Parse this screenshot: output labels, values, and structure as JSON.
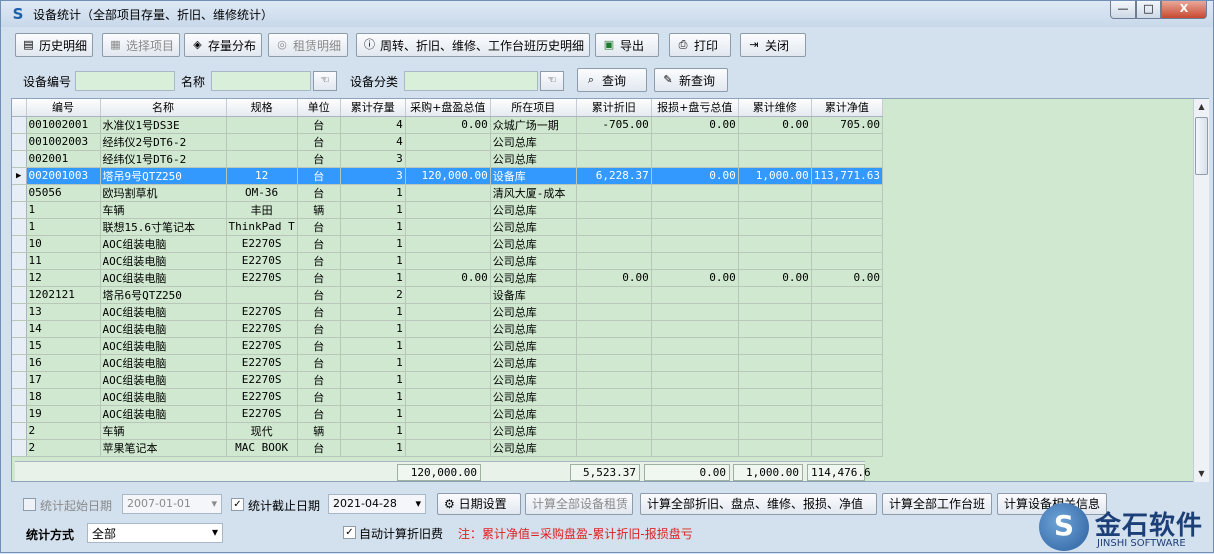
{
  "window": {
    "title": "设备统计（全部项目存量、折旧、维修统计）",
    "min": "—",
    "max": "□",
    "close": "X"
  },
  "toolbar": {
    "history": "历史明细",
    "select_project": "选择项目",
    "stock_dist": "存量分布",
    "rent_detail": "租赁明细",
    "turnover": "周转、折旧、维修、工作台班历史明细",
    "export": "导出",
    "print": "打印",
    "close": "关闭"
  },
  "search": {
    "code_label": "设备编号",
    "name_label": "名称",
    "category_label": "设备分类",
    "query": "查询",
    "new_query": "新查询"
  },
  "grid": {
    "columns": [
      "编号",
      "名称",
      "规格",
      "单位",
      "累计存量",
      "采购+盘盈总值",
      "所在项目",
      "累计折旧",
      "报损+盘亏总值",
      "累计维修",
      "累计净值"
    ],
    "rows": [
      [
        "001002001",
        "水准仪1号DS3E",
        "",
        "台",
        "4",
        "0.00",
        "众城广场一期",
        "-705.00",
        "0.00",
        "0.00",
        "705.00"
      ],
      [
        "001002003",
        "经纬仪2号DT6-2",
        "",
        "台",
        "4",
        "",
        "公司总库",
        "",
        "",
        "",
        ""
      ],
      [
        "002001",
        "经纬仪1号DT6-2",
        "",
        "台",
        "3",
        "",
        "公司总库",
        "",
        "",
        "",
        ""
      ],
      [
        "002001003",
        "塔吊9号QTZ250",
        "12",
        "台",
        "3",
        "120,000.00",
        "设备库",
        "6,228.37",
        "0.00",
        "1,000.00",
        "113,771.63"
      ],
      [
        "05056",
        "欧玛割草机",
        "OM-36",
        "台",
        "1",
        "",
        "清风大厦-成本",
        "",
        "",
        "",
        ""
      ],
      [
        "1",
        "车辆",
        "丰田",
        "辆",
        "1",
        "",
        "公司总库",
        "",
        "",
        "",
        ""
      ],
      [
        "1",
        "联想15.6寸笔记本",
        "ThinkPad T",
        "台",
        "1",
        "",
        "公司总库",
        "",
        "",
        "",
        ""
      ],
      [
        "10",
        "AOC组装电脑",
        "E2270S",
        "台",
        "1",
        "",
        "公司总库",
        "",
        "",
        "",
        ""
      ],
      [
        "11",
        "AOC组装电脑",
        "E2270S",
        "台",
        "1",
        "",
        "公司总库",
        "",
        "",
        "",
        ""
      ],
      [
        "12",
        "AOC组装电脑",
        "E2270S",
        "台",
        "1",
        "0.00",
        "公司总库",
        "0.00",
        "0.00",
        "0.00",
        "0.00"
      ],
      [
        "1202121",
        "塔吊6号QTZ250",
        "",
        "台",
        "2",
        "",
        "设备库",
        "",
        "",
        "",
        ""
      ],
      [
        "13",
        "AOC组装电脑",
        "E2270S",
        "台",
        "1",
        "",
        "公司总库",
        "",
        "",
        "",
        ""
      ],
      [
        "14",
        "AOC组装电脑",
        "E2270S",
        "台",
        "1",
        "",
        "公司总库",
        "",
        "",
        "",
        ""
      ],
      [
        "15",
        "AOC组装电脑",
        "E2270S",
        "台",
        "1",
        "",
        "公司总库",
        "",
        "",
        "",
        ""
      ],
      [
        "16",
        "AOC组装电脑",
        "E2270S",
        "台",
        "1",
        "",
        "公司总库",
        "",
        "",
        "",
        ""
      ],
      [
        "17",
        "AOC组装电脑",
        "E2270S",
        "台",
        "1",
        "",
        "公司总库",
        "",
        "",
        "",
        ""
      ],
      [
        "18",
        "AOC组装电脑",
        "E2270S",
        "台",
        "1",
        "",
        "公司总库",
        "",
        "",
        "",
        ""
      ],
      [
        "19",
        "AOC组装电脑",
        "E2270S",
        "台",
        "1",
        "",
        "公司总库",
        "",
        "",
        "",
        ""
      ],
      [
        "2",
        "车辆",
        "现代",
        "辆",
        "1",
        "",
        "公司总库",
        "",
        "",
        "",
        ""
      ],
      [
        "2",
        "苹果笔记本",
        "MAC BOOK",
        "台",
        "1",
        "",
        "公司总库",
        "",
        "",
        "",
        ""
      ]
    ],
    "selected_row": 3,
    "totals": {
      "purchase": "120,000.00",
      "depreciation": "5,523.37",
      "loss": "0.00",
      "repair": "1,000.00",
      "net": "114,476.6"
    }
  },
  "bottom": {
    "start_date_label": "统计起始日期",
    "start_date": "2007-01-01",
    "end_date_label": "统计截止日期",
    "end_date": "2021-04-28",
    "date_settings": "日期设置",
    "calc_rent": "计算全部设备租赁",
    "calc_depr": "计算全部折旧、盘点、维修、报损、净值",
    "calc_shift": "计算全部工作台班",
    "calc_info": "计算设备相关信息",
    "mode_label": "统计方式",
    "mode_value": "全部",
    "auto_calc": "自动计算折旧费",
    "note": "注：累计净值=采购盘盈-累计折旧-报损盘亏"
  },
  "logo": {
    "cn": "金石软件",
    "en": "JINSHI SOFTWARE",
    "mark": "S"
  }
}
